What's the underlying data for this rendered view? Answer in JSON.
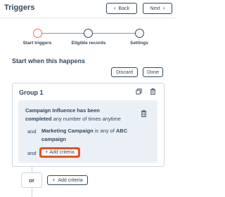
{
  "header": {
    "title": "Triggers",
    "back_label": "Back",
    "next_label": "Next"
  },
  "stepper": {
    "steps": [
      {
        "label": "Start triggers",
        "active": true
      },
      {
        "label": "Eligible records",
        "active": false
      },
      {
        "label": "Settings",
        "active": false
      }
    ]
  },
  "section": {
    "heading": "Start when this happens",
    "discard_label": "Discard",
    "done_label": "Done"
  },
  "group": {
    "title": "Group 1",
    "criteria": {
      "line1_bold": "Campaign Influence has been",
      "line2_bold": "completed",
      "line2_rest": " any number of times anytime",
      "and1": "and",
      "line3_bold": "Marketing Campaign",
      "line3_mid": " is any of ",
      "line3_value": "ABC",
      "line4_value": "campaign",
      "and2": "and",
      "add_criteria_label": "Add criteria"
    }
  },
  "footer": {
    "or_label": "or",
    "add_criteria_label": "Add criteria"
  },
  "colors": {
    "accent": "#e0542b",
    "text": "#33475b",
    "criteria_bg": "#eaf0f6",
    "border": "#cbd6e2"
  },
  "icons": {
    "prev": "chevron-left-icon",
    "next": "chevron-right-icon",
    "copy": "clone-icon",
    "delete": "trash-icon",
    "add": "plus-icon"
  }
}
